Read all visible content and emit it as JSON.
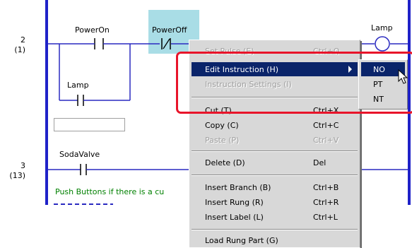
{
  "rungs": [
    {
      "number": "2",
      "step": "(1)"
    },
    {
      "number": "3",
      "step": "(13)"
    }
  ],
  "contacts": {
    "power_on": "PowerOn",
    "power_off": "PowerOff",
    "lamp_branch": "Lamp",
    "soda_valve": "SodaValve",
    "lamp_coil": "Lamp"
  },
  "comment": "Push Buttons if there is a cu",
  "context_menu": {
    "items": [
      {
        "label": "Set Pulse (E)",
        "shortcut": "Ctrl+Q",
        "enabled": false
      },
      {
        "label": "Edit Instruction (H)",
        "shortcut": "",
        "enabled": true
      },
      {
        "label": "Instruction Settings (I)",
        "shortcut": "",
        "enabled": false
      },
      {
        "label": "Cut (T)",
        "shortcut": "Ctrl+X",
        "enabled": true
      },
      {
        "label": "Copy (C)",
        "shortcut": "Ctrl+C",
        "enabled": true
      },
      {
        "label": "Paste (P)",
        "shortcut": "Ctrl+V",
        "enabled": false
      },
      {
        "label": "Delete (D)",
        "shortcut": "Del",
        "enabled": true
      },
      {
        "label": "Insert Branch (B)",
        "shortcut": "Ctrl+B",
        "enabled": true
      },
      {
        "label": "Insert Rung (R)",
        "shortcut": "Ctrl+R",
        "enabled": true
      },
      {
        "label": "Insert Label (L)",
        "shortcut": "Ctrl+L",
        "enabled": true
      },
      {
        "label": "Load Rung Part (G)",
        "shortcut": "",
        "enabled": true
      }
    ]
  },
  "submenu": {
    "items": [
      "NO",
      "PT",
      "NT"
    ]
  },
  "colors": {
    "rail": "#1f22c8",
    "highlight": "#0a246a",
    "callout": "#e8142a",
    "selection": "#a9dde6",
    "comment_text": "#008000"
  }
}
